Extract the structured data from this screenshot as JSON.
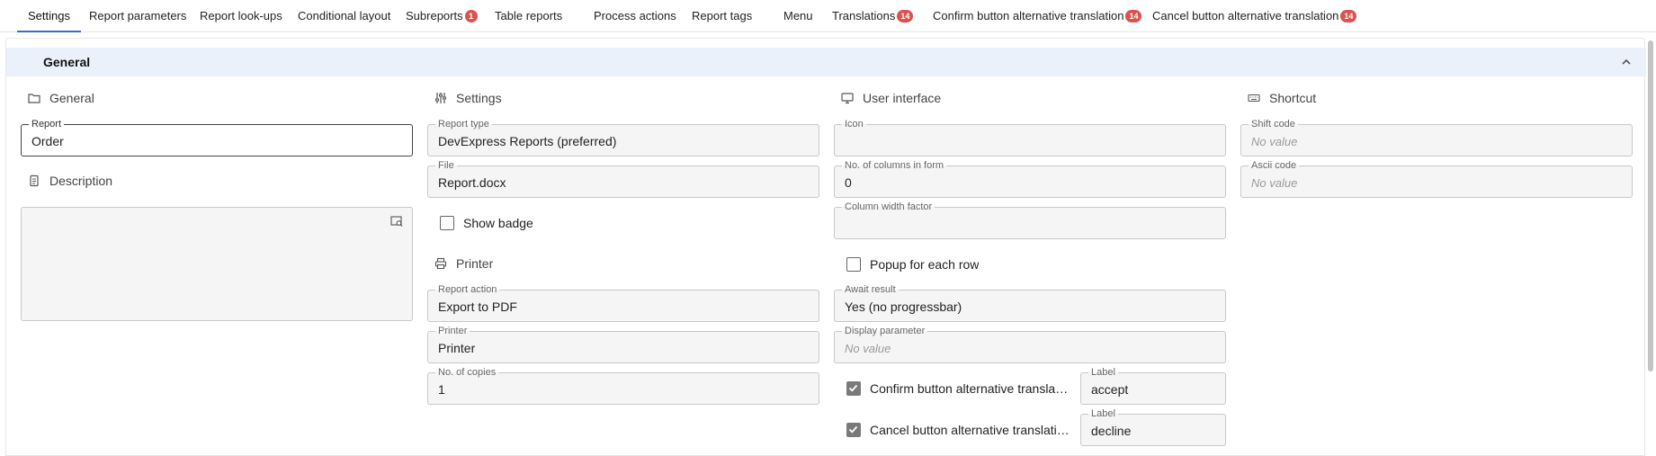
{
  "tabs": [
    {
      "label": "Settings",
      "badge": ""
    },
    {
      "label": "Report parameters",
      "badge": ""
    },
    {
      "label": "Report look-ups",
      "badge": ""
    },
    {
      "label": "Conditional layout",
      "badge": ""
    },
    {
      "label": "Subreports",
      "badge": "1"
    },
    {
      "label": "Table reports",
      "badge": ""
    },
    {
      "label": "Process actions",
      "badge": ""
    },
    {
      "label": "Report tags",
      "badge": ""
    },
    {
      "label": "Menu",
      "badge": ""
    },
    {
      "label": "Translations",
      "badge": "14"
    },
    {
      "label": "Confirm button alternative translation",
      "badge": "14"
    },
    {
      "label": "Cancel button alternative translation",
      "badge": "14"
    }
  ],
  "panel": {
    "title": "General"
  },
  "sections": {
    "general": "General",
    "description": "Description",
    "settings": "Settings",
    "printer": "Printer",
    "user_interface": "User interface",
    "shortcut": "Shortcut"
  },
  "general": {
    "report": {
      "label": "Report",
      "value": "Order"
    }
  },
  "settings": {
    "report_type": {
      "label": "Report type",
      "value": "DevExpress Reports (preferred)"
    },
    "file": {
      "label": "File",
      "value": "Report.docx"
    },
    "show_badge": {
      "label": "Show badge",
      "checked": false
    }
  },
  "printer": {
    "report_action": {
      "label": "Report action",
      "value": "Export to PDF"
    },
    "printer": {
      "label": "Printer",
      "value": "Printer"
    },
    "copies": {
      "label": "No. of copies",
      "value": "1"
    }
  },
  "user_interface": {
    "icon": {
      "label": "Icon",
      "value": ""
    },
    "columns": {
      "label": "No. of columns in form",
      "value": "0"
    },
    "width_factor": {
      "label": "Column width factor",
      "value": ""
    },
    "popup": {
      "label": "Popup for each row",
      "checked": false
    },
    "await": {
      "label": "Await result",
      "value": "Yes (no progressbar)"
    },
    "display_param": {
      "label": "Display parameter",
      "placeholder": "No value"
    },
    "confirm": {
      "label": "Confirm button alternative translation",
      "checked": true,
      "field_label": "Label",
      "field_value": "accept"
    },
    "cancel": {
      "label": "Cancel button alternative translation",
      "checked": true,
      "field_label": "Label",
      "field_value": "decline"
    }
  },
  "shortcut": {
    "shift_code": {
      "label": "Shift code",
      "placeholder": "No value"
    },
    "ascii_code": {
      "label": "Ascii code",
      "placeholder": "No value"
    }
  },
  "colors": {
    "accent": "#2e6fd0",
    "badge": "#d9534f",
    "header_bg": "#eaf1fa"
  }
}
